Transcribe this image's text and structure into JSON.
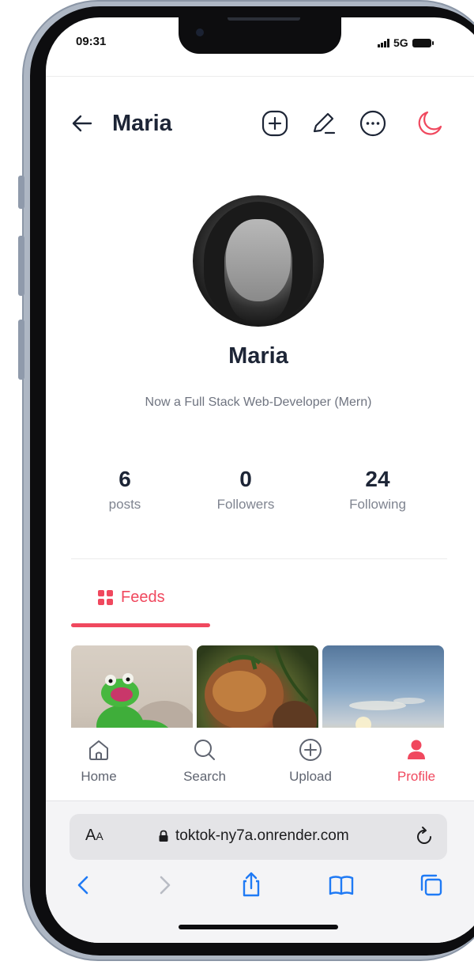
{
  "status_bar": {
    "time": "09:31",
    "network": "5G"
  },
  "header": {
    "title": "Maria",
    "icons": [
      "back-arrow-icon",
      "add-post-icon",
      "edit-icon",
      "more-icon",
      "dark-mode-icon"
    ]
  },
  "profile": {
    "name": "Maria",
    "bio": "Now a Full Stack Web-Developer (Mern)",
    "stats": [
      {
        "value": "6",
        "label": "posts"
      },
      {
        "value": "0",
        "label": "Followers"
      },
      {
        "value": "24",
        "label": "Following"
      }
    ]
  },
  "feeds_tab": {
    "label": "Feeds"
  },
  "bottom_nav": {
    "items": [
      {
        "label": "Home",
        "icon": "home-icon"
      },
      {
        "label": "Search",
        "icon": "search-icon"
      },
      {
        "label": "Upload",
        "icon": "upload-icon"
      },
      {
        "label": "Profile",
        "icon": "profile-icon",
        "active": true
      }
    ]
  },
  "browser": {
    "text_size_label_big": "A",
    "text_size_label_small": "A",
    "url": "toktok-ny7a.onrender.com"
  },
  "colors": {
    "accent": "#f0485e",
    "title": "#1d2536",
    "muted": "#7f8490",
    "safari_blue": "#1f7af5"
  }
}
